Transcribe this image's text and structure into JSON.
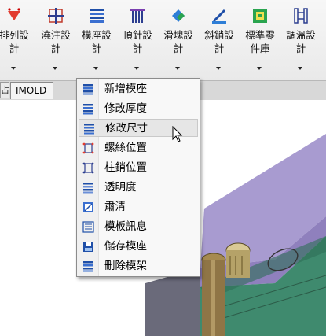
{
  "toolbar": {
    "buttons": [
      {
        "line1": "排列設",
        "line2": "計",
        "icon": "arrange-design-icon"
      },
      {
        "line1": "澆注設",
        "line2": "計",
        "icon": "pour-design-icon"
      },
      {
        "line1": "模座設",
        "line2": "計",
        "icon": "mold-base-design-icon"
      },
      {
        "line1": "頂針設",
        "line2": "計",
        "icon": "ejector-pin-design-icon"
      },
      {
        "line1": "滑塊設",
        "line2": "計",
        "icon": "slider-design-icon"
      },
      {
        "line1": "斜銷設",
        "line2": "計",
        "icon": "angle-pin-design-icon"
      },
      {
        "line1": "標準零",
        "line2": "件庫",
        "icon": "standard-parts-library-icon"
      },
      {
        "line1": "調溫設",
        "line2": "計",
        "icon": "temperature-control-design-icon"
      }
    ]
  },
  "tabs": {
    "prev": "占",
    "active": "IMOLD"
  },
  "menu": {
    "items": [
      {
        "label": "新增模座",
        "icon": "new-mold-base-icon"
      },
      {
        "label": "修改厚度",
        "icon": "modify-thickness-icon"
      },
      {
        "label": "修改尺寸",
        "icon": "modify-size-icon",
        "hover": true
      },
      {
        "label": "螺絲位置",
        "icon": "screw-position-icon"
      },
      {
        "label": "柱銷位置",
        "icon": "pin-position-icon"
      },
      {
        "label": "透明度",
        "icon": "transparency-icon"
      },
      {
        "label": "肅清",
        "icon": "clear-icon"
      },
      {
        "label": "模板訊息",
        "icon": "plate-info-icon"
      },
      {
        "label": "儲存模座",
        "icon": "save-mold-base-icon"
      },
      {
        "label": "刪除模架",
        "icon": "delete-mold-frame-icon"
      }
    ]
  },
  "colors": {
    "accent_blue": "#1f4fa8",
    "model_purple": "#a89bd0",
    "model_green": "#3f8a6e",
    "menu_hover": "#e6e6e6"
  }
}
